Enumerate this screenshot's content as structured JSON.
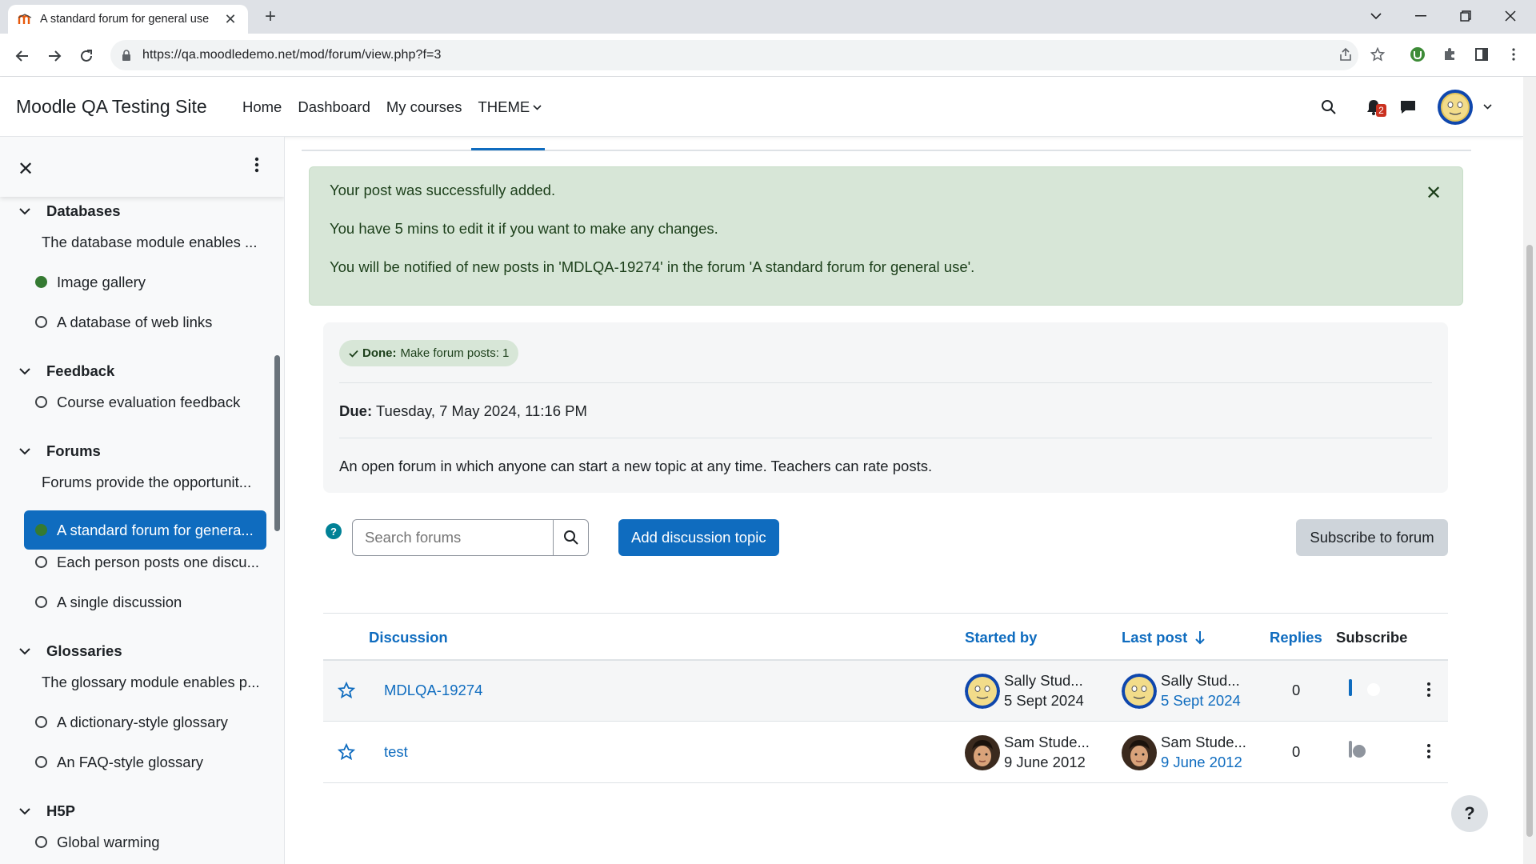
{
  "browser": {
    "tab_title": "A standard forum for general use",
    "url": "https://qa.moodledemo.net/mod/forum/view.php?f=3"
  },
  "navbar": {
    "site_name": "Moodle QA Testing Site",
    "links": [
      "Home",
      "Dashboard",
      "My courses",
      "THEME"
    ],
    "notification_count": "2"
  },
  "drawer": {
    "sections": [
      {
        "title": "Databases"
      },
      {
        "title": "Feedback"
      },
      {
        "title": "Forums"
      },
      {
        "title": "Glossaries"
      },
      {
        "title": "H5P"
      }
    ],
    "items": [
      {
        "label": "The database module enables ...",
        "type": "plain"
      },
      {
        "label": "Image gallery",
        "type": "done"
      },
      {
        "label": "A database of web links",
        "type": "todo"
      },
      {
        "label": "Course evaluation feedback",
        "type": "todo"
      },
      {
        "label": "Forums provide the opportunit...",
        "type": "plain"
      },
      {
        "label": "A standard forum for genera...",
        "type": "active"
      },
      {
        "label": "Each person posts one discu...",
        "type": "todo"
      },
      {
        "label": "A single discussion",
        "type": "todo"
      },
      {
        "label": "The glossary module enables p...",
        "type": "plain"
      },
      {
        "label": "A dictionary-style glossary",
        "type": "todo"
      },
      {
        "label": "An FAQ-style glossary",
        "type": "todo"
      },
      {
        "label": "Global warming",
        "type": "todo"
      }
    ]
  },
  "alert": {
    "line1": "Your post was successfully added.",
    "line2": "You have 5 mins to edit it if you want to make any changes.",
    "line3": "You will be notified of new posts in 'MDLQA-19274' in the forum 'A standard forum for general use'."
  },
  "activity": {
    "completion_done": "Done:",
    "completion_text": "Make forum posts: 1",
    "due_label": "Due:",
    "due_value": "Tuesday, 7 May 2024, 11:16 PM",
    "description": "An open forum in which anyone can start a new topic at any time. Teachers can rate posts."
  },
  "toolbar": {
    "search_placeholder": "Search forums",
    "add_discussion": "Add discussion topic",
    "subscribe": "Subscribe to forum"
  },
  "table": {
    "headers": {
      "discussion": "Discussion",
      "started_by": "Started by",
      "last_post": "Last post",
      "replies": "Replies",
      "subscribe": "Subscribe"
    },
    "rows": [
      {
        "title": "MDLQA-19274",
        "started_name": "Sally Stud...",
        "started_date": "5 Sept 2024",
        "last_name": "Sally Stud...",
        "last_date": "5 Sept 2024",
        "replies": "0",
        "subscribed": true
      },
      {
        "title": "test",
        "started_name": "Sam Stude...",
        "started_date": "9 June 2012",
        "last_name": "Sam Stude...",
        "last_date": "9 June 2012",
        "replies": "0",
        "subscribed": false
      }
    ]
  },
  "help_button": "?",
  "colors": {
    "primary": "#0f6cbf",
    "success_bg": "#d7e6d7",
    "done_dot": "#357a32"
  }
}
